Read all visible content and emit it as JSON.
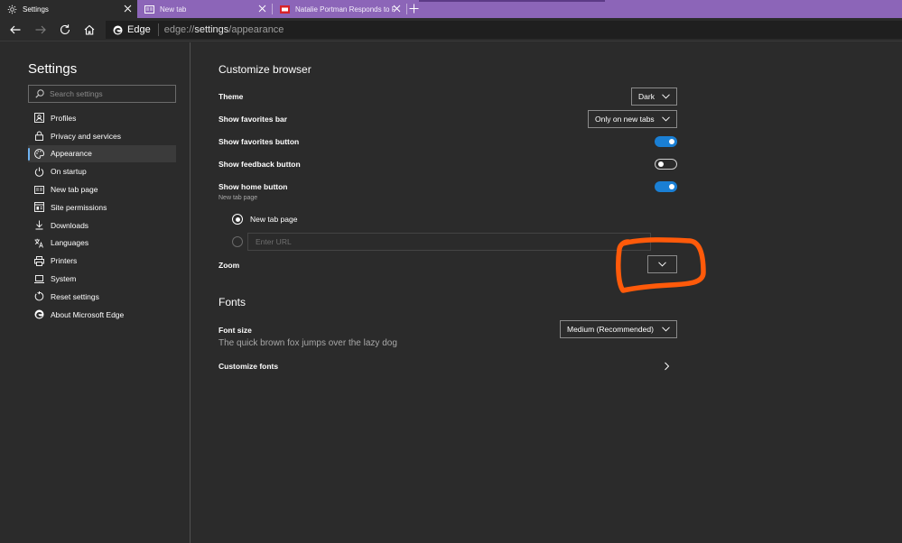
{
  "tabs": [
    {
      "title": "Settings",
      "icon": "gear-icon"
    },
    {
      "title": "New tab",
      "icon": "new-tab-page-icon"
    },
    {
      "title": "Natalie Portman Responds to Re",
      "icon": "news-favicon-icon"
    }
  ],
  "toolbar": {
    "site_label": "Edge",
    "url_scheme": "edge://",
    "url_host": "settings",
    "url_path": "/appearance"
  },
  "sidebar": {
    "title": "Settings",
    "search_placeholder": "Search settings",
    "items": [
      {
        "label": "Profiles",
        "icon": "profile-icon"
      },
      {
        "label": "Privacy and services",
        "icon": "lock-icon"
      },
      {
        "label": "Appearance",
        "icon": "palette-icon",
        "selected": true
      },
      {
        "label": "On startup",
        "icon": "power-icon"
      },
      {
        "label": "New tab page",
        "icon": "new-tab-page-icon"
      },
      {
        "label": "Site permissions",
        "icon": "site-permissions-icon"
      },
      {
        "label": "Downloads",
        "icon": "download-icon"
      },
      {
        "label": "Languages",
        "icon": "languages-icon"
      },
      {
        "label": "Printers",
        "icon": "printer-icon"
      },
      {
        "label": "System",
        "icon": "laptop-icon"
      },
      {
        "label": "Reset settings",
        "icon": "reset-icon"
      },
      {
        "label": "About Microsoft Edge",
        "icon": "edge-logo-icon"
      }
    ]
  },
  "customize": {
    "title": "Customize browser",
    "theme_label": "Theme",
    "theme_value": "Dark",
    "favorites_bar_label": "Show favorites bar",
    "favorites_bar_value": "Only on new tabs",
    "favorites_button_label": "Show favorites button",
    "favorites_button_on": true,
    "feedback_button_label": "Show feedback button",
    "feedback_button_on": false,
    "home_button_label": "Show home button",
    "home_button_on": true,
    "home_sublabel": "New tab page",
    "home_option_new_tab": "New tab page",
    "home_url_placeholder": "Enter URL",
    "zoom_label": "Zoom",
    "zoom_value": ""
  },
  "fonts": {
    "title": "Fonts",
    "font_size_label": "Font size",
    "font_size_value": "Medium (Recommended)",
    "preview_text": "The quick brown fox jumps over the lazy dog",
    "customize_fonts_label": "Customize fonts"
  },
  "colors": {
    "tabstrip": "#8c65b8",
    "toggle_on": "#1a7fd4",
    "selected_accent": "#6fb3f2",
    "annotation": "#ff5a0a"
  }
}
